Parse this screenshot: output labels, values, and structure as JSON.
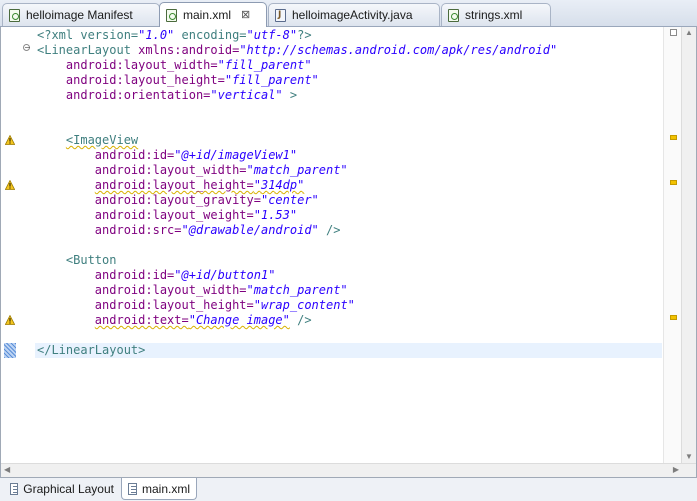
{
  "tabs": [
    {
      "label": "helloimage Manifest",
      "icon": "android-xml-icon",
      "active": false
    },
    {
      "label": "main.xml",
      "icon": "android-xml-icon",
      "active": true,
      "close": "⊠"
    },
    {
      "label": "helloimageActivity.java",
      "icon": "java-file-icon",
      "active": false
    },
    {
      "label": "strings.xml",
      "icon": "android-xml-icon",
      "active": false
    }
  ],
  "code": {
    "l1": {
      "a": "<?xml version=",
      "b": "\"1.0\"",
      "c": " encoding=",
      "d": "\"utf-8\"",
      "e": "?>"
    },
    "l2": {
      "tag": "<LinearLayout ",
      "attr": "xmlns:android=",
      "val": "\"http://schemas.android.com/apk/res/android\""
    },
    "l3": {
      "attr": "android:layout_width=",
      "val": "\"fill_parent\""
    },
    "l4": {
      "attr": "android:layout_height=",
      "val": "\"fill_parent\""
    },
    "l5": {
      "attr": "android:orientation=",
      "val": "\"vertical\"",
      "end": " >"
    },
    "l6": {
      "tag": "<ImageView"
    },
    "l7": {
      "attr": "android:id=",
      "val": "\"@+id/imageView1\""
    },
    "l8": {
      "attr": "android:layout_width=",
      "val": "\"match_parent\""
    },
    "l9": {
      "attr": "android:layout_height=",
      "val": "\"314dp\""
    },
    "l10": {
      "attr": "android:layout_gravity=",
      "val": "\"center\""
    },
    "l11": {
      "attr": "android:layout_weight=",
      "val": "\"1.53\""
    },
    "l12": {
      "attr": "android:src=",
      "val": "\"@drawable/android\"",
      "end": " />"
    },
    "l13": {
      "tag": "<Button"
    },
    "l14": {
      "attr": "android:id=",
      "val": "\"@+id/button1\""
    },
    "l15": {
      "attr": "android:layout_width=",
      "val": "\"match_parent\""
    },
    "l16": {
      "attr": "android:layout_height=",
      "val": "\"wrap_content\""
    },
    "l17": {
      "attr": "android:text=",
      "val": "\"Change image\"",
      "end": " />"
    },
    "l18": {
      "tag": "</LinearLayout>"
    }
  },
  "bottom_tabs": [
    {
      "label": "Graphical Layout",
      "active": false
    },
    {
      "label": "main.xml",
      "active": true
    }
  ],
  "colors": {
    "tag": "#3f7f7f",
    "attribute": "#7f007f",
    "value": "#2a00ff",
    "warning": "#f2c200",
    "current_line": "#e8f2fe"
  }
}
